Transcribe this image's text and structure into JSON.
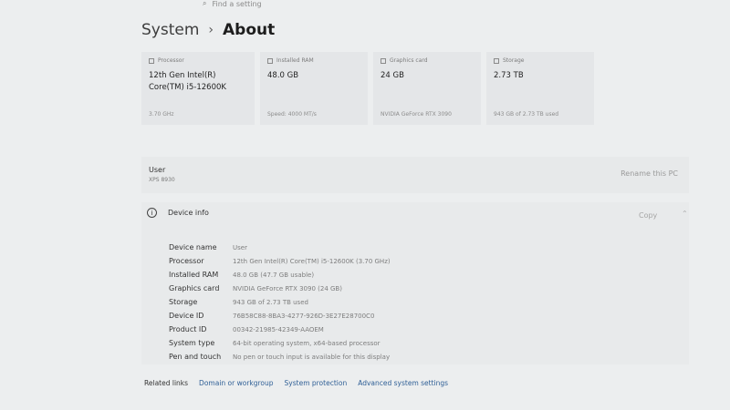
{
  "search": {
    "placeholder": "Find a setting"
  },
  "breadcrumb": {
    "parent": "System",
    "separator": "›",
    "current": "About"
  },
  "cards": [
    {
      "label": "Processor",
      "value": "12th Gen Intel(R) Core(TM) i5-12600K",
      "sub": "3.70 GHz",
      "icon": "processor-icon"
    },
    {
      "label": "Installed RAM",
      "value": "48.0 GB",
      "sub": "Speed: 4000 MT/s",
      "icon": "ram-icon"
    },
    {
      "label": "Graphics card",
      "value": "24 GB",
      "sub": "NVIDIA GeForce RTX 3090",
      "icon": "graphics-card-icon"
    },
    {
      "label": "Storage",
      "value": "2.73 TB",
      "sub": "943 GB of 2.73 TB used",
      "icon": "storage-icon"
    }
  ],
  "user": {
    "name": "User",
    "model": "XPS 8930",
    "rename": "Rename this PC"
  },
  "device_info": {
    "title": "Device info",
    "copy": "Copy",
    "rows": [
      {
        "key": "Device name",
        "value": "User"
      },
      {
        "key": "Processor",
        "value": "12th Gen Intel(R) Core(TM) i5-12600K (3.70 GHz)"
      },
      {
        "key": "Installed RAM",
        "value": "48.0 GB (47.7 GB usable)"
      },
      {
        "key": "Graphics card",
        "value": "NVIDIA GeForce RTX 3090 (24 GB)"
      },
      {
        "key": "Storage",
        "value": "943 GB of 2.73 TB used"
      },
      {
        "key": "Device ID",
        "value": "76B58C88-8BA3-4277-926D-3E27E28700C0"
      },
      {
        "key": "Product ID",
        "value": "00342-21985-42349-AAOEM"
      },
      {
        "key": "System type",
        "value": "64-bit operating system, x64-based processor"
      },
      {
        "key": "Pen and touch",
        "value": "No pen or touch input is available for this display"
      }
    ]
  },
  "related": {
    "label": "Related links",
    "links": [
      "Domain or workgroup",
      "System protection",
      "Advanced system settings"
    ]
  }
}
